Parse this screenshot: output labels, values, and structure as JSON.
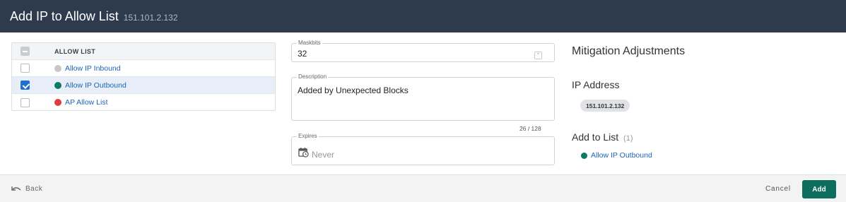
{
  "header": {
    "title": "Add IP to Allow List",
    "subtitle": "151.101.2.132"
  },
  "allow_list": {
    "column_header": "ALLOW LIST",
    "rows": [
      {
        "label": "Allow IP Inbound",
        "color": "#c8c8c8",
        "checked": false
      },
      {
        "label": "Allow IP Outbound",
        "color": "#0d7a63",
        "checked": true
      },
      {
        "label": "AP Allow List",
        "color": "#e03c3c",
        "checked": false
      }
    ]
  },
  "form": {
    "maskbits": {
      "label": "Maskbits",
      "value": "32"
    },
    "description": {
      "label": "Description",
      "value": "Added by Unexpected Blocks",
      "counter": "26 / 128"
    },
    "expires": {
      "label": "Expires",
      "placeholder": "Never"
    }
  },
  "summary": {
    "title": "Mitigation Adjustments",
    "ip_heading": "IP Address",
    "ip_value": "151.101.2.132",
    "add_heading": "Add to List",
    "add_count": "(1)",
    "items": [
      {
        "label": "Allow IP Outbound",
        "color": "#0d7a63"
      }
    ]
  },
  "footer": {
    "back_label": "Back",
    "cancel_label": "Cancel",
    "add_label": "Add"
  }
}
